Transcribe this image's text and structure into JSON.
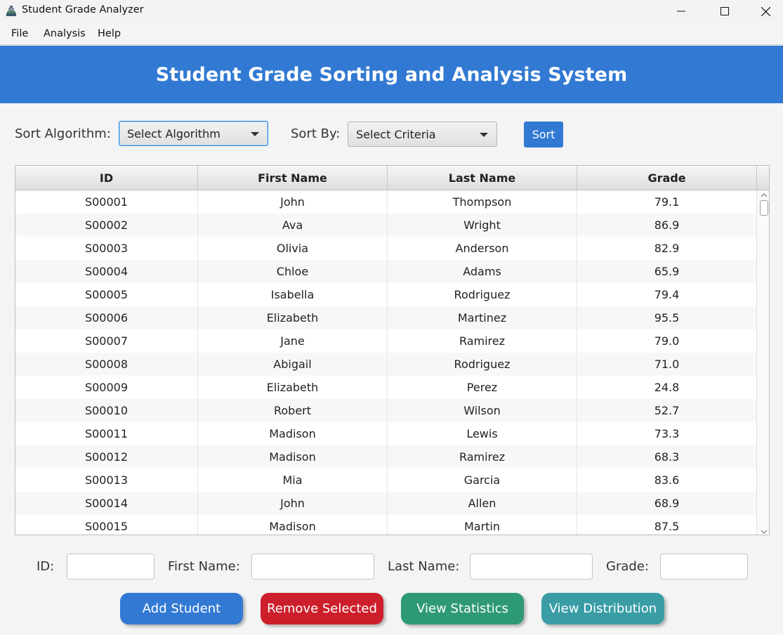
{
  "window": {
    "title": "Student Grade Analyzer",
    "minimize_glyph": "—",
    "maximize_glyph": "☐",
    "close_glyph": "✕"
  },
  "menu": [
    "File",
    "Analysis",
    "Help"
  ],
  "header": {
    "title": "Student Grade Sorting and Analysis System",
    "color": "#3179d3"
  },
  "controls": {
    "algorithm_label": "Sort Algorithm:",
    "algorithm_value": "Select Algorithm",
    "criteria_label": "Sort By:",
    "criteria_value": "Select Criteria",
    "sort_button": "Sort"
  },
  "table": {
    "columns": [
      "ID",
      "First Name",
      "Last Name",
      "Grade"
    ],
    "rows": [
      [
        "S00001",
        "John",
        "Thompson",
        "79.1"
      ],
      [
        "S00002",
        "Ava",
        "Wright",
        "86.9"
      ],
      [
        "S00003",
        "Olivia",
        "Anderson",
        "82.9"
      ],
      [
        "S00004",
        "Chloe",
        "Adams",
        "65.9"
      ],
      [
        "S00005",
        "Isabella",
        "Rodriguez",
        "79.4"
      ],
      [
        "S00006",
        "Elizabeth",
        "Martinez",
        "95.5"
      ],
      [
        "S00007",
        "Jane",
        "Ramirez",
        "79.0"
      ],
      [
        "S00008",
        "Abigail",
        "Rodriguez",
        "71.0"
      ],
      [
        "S00009",
        "Elizabeth",
        "Perez",
        "24.8"
      ],
      [
        "S00010",
        "Robert",
        "Wilson",
        "52.7"
      ],
      [
        "S00011",
        "Madison",
        "Lewis",
        "73.3"
      ],
      [
        "S00012",
        "Madison",
        "Ramirez",
        "68.3"
      ],
      [
        "S00013",
        "Mia",
        "Garcia",
        "83.6"
      ],
      [
        "S00014",
        "John",
        "Allen",
        "68.9"
      ],
      [
        "S00015",
        "Madison",
        "Martin",
        "87.5"
      ]
    ]
  },
  "form": {
    "id_label": "ID:",
    "first_name_label": "First Name:",
    "last_name_label": "Last Name:",
    "grade_label": "Grade:"
  },
  "actions": {
    "add": {
      "label": "Add Student",
      "color": "#3179d3"
    },
    "remove": {
      "label": "Remove Selected",
      "color": "#cc1f2b"
    },
    "statistics": {
      "label": "View Statistics",
      "color": "#2e9a74"
    },
    "distribution": {
      "label": "View Distribution",
      "color": "#3a9da6"
    }
  }
}
